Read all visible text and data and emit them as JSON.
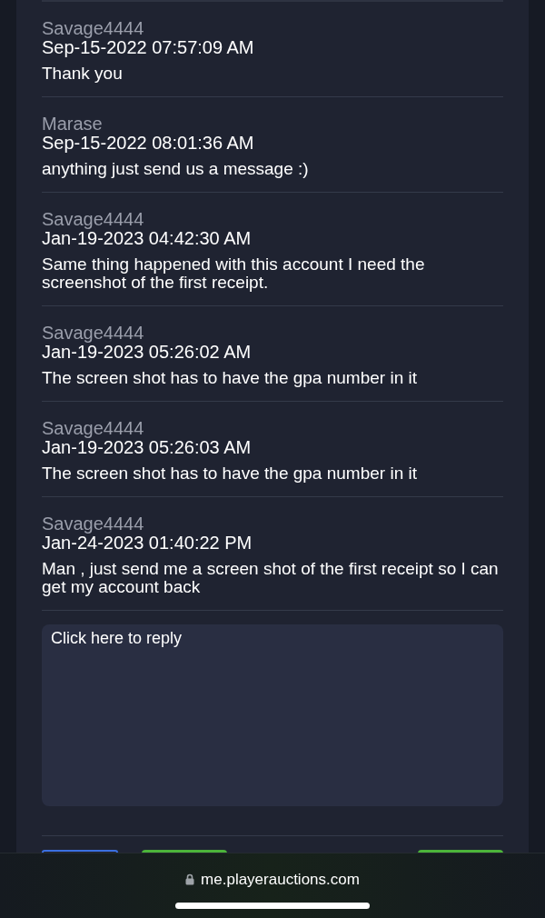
{
  "messages": [
    {
      "author": "Savage4444",
      "time": "Sep-15-2022 07:57:09 AM",
      "text": "Thank you"
    },
    {
      "author": "Marase",
      "time": "Sep-15-2022 08:01:36 AM",
      "text": "anything just send us a message :)"
    },
    {
      "author": "Savage4444",
      "time": "Jan-19-2023 04:42:30 AM",
      "text": "Same thing happened with this account I need the screenshot of the first receipt."
    },
    {
      "author": "Savage4444",
      "time": "Jan-19-2023 05:26:02 AM",
      "text": "The screen shot has to have the gpa number in it"
    },
    {
      "author": "Savage4444",
      "time": "Jan-19-2023 05:26:03 AM",
      "text": "The screen shot has to have the gpa number in it"
    },
    {
      "author": "Savage4444",
      "time": "Jan-24-2023 01:40:22 PM",
      "text": "Man , just send me a screen shot of the first receipt so I can get my account back"
    }
  ],
  "reply": {
    "placeholder": "Click here to reply"
  },
  "buttons": [
    {
      "kind": "outline"
    },
    {
      "kind": "filled"
    },
    {
      "kind": "spacer"
    },
    {
      "kind": "filled"
    }
  ],
  "browser": {
    "url": "me.playerauctions.com"
  }
}
